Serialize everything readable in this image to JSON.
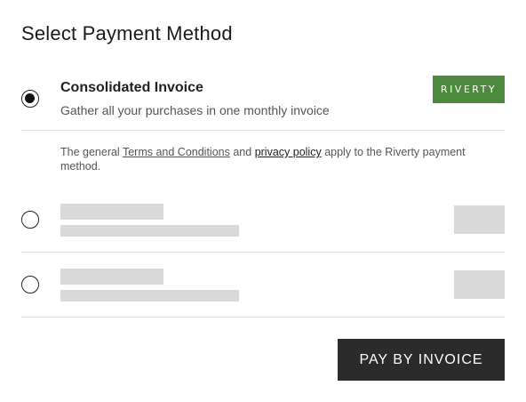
{
  "page": {
    "title": "Select Payment Method"
  },
  "options": [
    {
      "title": "Consolidated Invoice",
      "description": "Gather all your purchases in one monthly invoice",
      "selected": true,
      "brand": "RIVERTY",
      "brand_color": "#4e8a3e"
    },
    {
      "selected": false,
      "loading": true
    },
    {
      "selected": false,
      "loading": true
    }
  ],
  "legal": {
    "prefix": "The general ",
    "terms_link": "Terms and Conditions",
    "middle": " and ",
    "privacy_link": "privacy policy",
    "suffix": " apply to the Riverty payment method."
  },
  "actions": {
    "pay_label": "PAY BY INVOICE"
  },
  "colors": {
    "button_bg": "#2b2b2b",
    "skeleton": "#d9d9d9",
    "divider": "#e2e2e2"
  }
}
